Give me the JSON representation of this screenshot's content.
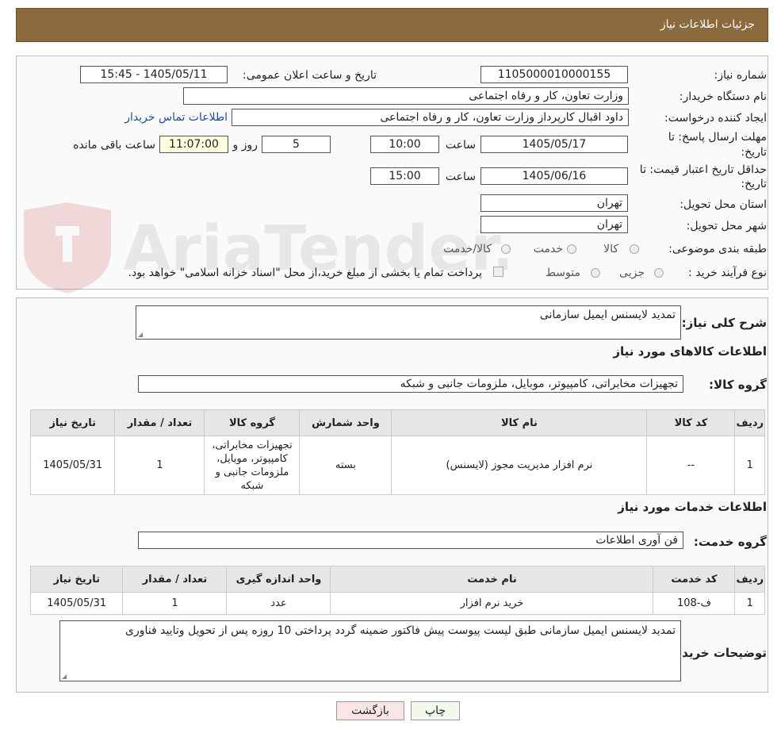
{
  "header": {
    "title": "جزئیات اطلاعات نیاز"
  },
  "watermark": {
    "text": "AriaTender.neT"
  },
  "form": {
    "need_number_label": "شماره نیاز:",
    "need_number": "1105000010000155",
    "announce_label": "تاریخ و ساعت اعلان عمومی:",
    "announce_value": "1405/05/11 - 15:45",
    "buyer_org_label": "نام دستگاه خریدار:",
    "buyer_org": "وزارت تعاون، کار و رفاه اجتماعی",
    "creator_label": "ایجاد کننده درخواست:",
    "creator": "داود اقبال کارپرداز وزارت تعاون، کار و رفاه اجتماعی",
    "contact_link": "اطلاعات تماس خریدار",
    "deadline_label_1": "مهلت ارسال پاسخ: تا",
    "deadline_label_2": "تاریخ:",
    "deadline_date": "1405/05/17",
    "hour_label": "ساعت",
    "deadline_time": "10:00",
    "days_value": "5",
    "days_label": "روز و",
    "remaining_time": "11:07:00",
    "remaining_label": "ساعت باقی مانده",
    "validity_label_1": "حداقل تاریخ اعتبار قیمت: تا",
    "validity_label_2": "تاریخ:",
    "validity_date": "1405/06/16",
    "validity_time": "15:00",
    "province_label": "استان محل تحویل:",
    "province": "تهران",
    "city_label": "شهر محل تحویل:",
    "city": "تهران",
    "category_label": "طبقه بندی موضوعی:",
    "category_options": [
      "کالا",
      "خدمت",
      "کالا/خدمت"
    ],
    "process_label": "نوع فرآیند خرید :",
    "process_options": [
      "جزیی",
      "متوسط"
    ],
    "payment_note": "پرداخت تمام یا بخشی از مبلغ خرید،از محل \"اسناد خزانه اسلامی\" خواهد بود."
  },
  "details": {
    "desc_label": "شرح کلی نیاز:",
    "desc_value": "تمدید  لایسنس ایمیل سازمانی",
    "goods_title": "اطلاعات کالاهای مورد نیاز",
    "goods_group_label": "گروه کالا:",
    "goods_group_value": "تجهیزات مخابراتی، کامپیوتر، موبایل، ملزومات جانبی و شبکه",
    "goods_headers": [
      "ردیف",
      "کد کالا",
      "نام کالا",
      "واحد شمارش",
      "گروه کالا",
      "تعداد / مقدار",
      "تاریخ نیاز"
    ],
    "goods_row": [
      "1",
      "--",
      "نرم افزار مدیریت مجوز (لایسنس)",
      "بسته",
      "تجهیزات مخابراتی، کامپیوتر، موبایل، ملزومات جانبی و شبکه",
      "1",
      "1405/05/31"
    ],
    "services_title": "اطلاعات خدمات مورد نیاز",
    "service_group_label": "گروه خدمت:",
    "service_group_value": "فن آوری اطلاعات",
    "service_headers": [
      "ردیف",
      "کد خدمت",
      "نام خدمت",
      "واحد اندازه گیری",
      "تعداد / مقدار",
      "تاریخ نیاز"
    ],
    "service_row": [
      "1",
      "ف-108",
      "خرید نرم افزار",
      "عدد",
      "1",
      "1405/05/31"
    ],
    "buyer_notes_label": "توضیحات خریدار:",
    "buyer_notes": "تمدید لایسنس ایمیل سازمانی طبق لیست پیوست پیش فاکتور ضمینه گردد پرداختی 10 روزه پس از تحویل وتایید فناوری"
  },
  "buttons": {
    "print": "چاپ",
    "back": "بازگشت"
  }
}
